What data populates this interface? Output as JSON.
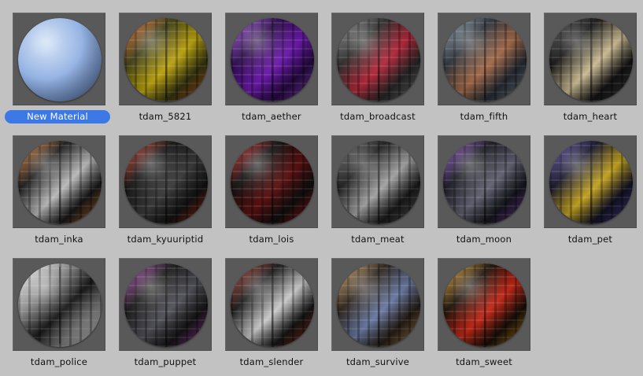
{
  "materials": [
    {
      "label": "New Material",
      "selected": true,
      "icon": "default-material-sphere-icon",
      "colors": [
        "#c9dbf3",
        "#95b3e3",
        "#5f7fb8"
      ]
    },
    {
      "label": "tdam_5821",
      "selected": false,
      "icon": "tdam-5821-material-sphere-icon",
      "colors": [
        "#e0601a",
        "#b8a010",
        "#3a3a12"
      ]
    },
    {
      "label": "tdam_aether",
      "selected": false,
      "icon": "tdam-aether-material-sphere-icon",
      "colors": [
        "#a04ee0",
        "#6a1aa8",
        "#2a0a48"
      ]
    },
    {
      "label": "tdam_broadcast",
      "selected": false,
      "icon": "tdam-broadcast-material-sphere-icon",
      "colors": [
        "#8a8a8a",
        "#b0283a",
        "#2a2a2a"
      ]
    },
    {
      "label": "tdam_fifth",
      "selected": false,
      "icon": "tdam-fifth-material-sphere-icon",
      "colors": [
        "#8a9aa8",
        "#a06848",
        "#2a3038"
      ]
    },
    {
      "label": "tdam_heart",
      "selected": false,
      "icon": "tdam-heart-material-sphere-icon",
      "colors": [
        "#4a4a4a",
        "#c8b890",
        "#151515"
      ]
    },
    {
      "label": "tdam_inka",
      "selected": false,
      "icon": "tdam-inka-material-sphere-icon",
      "colors": [
        "#e07a28",
        "#b8b8b8",
        "#1a1a1a"
      ]
    },
    {
      "label": "tdam_kyuuriptid",
      "selected": false,
      "icon": "tdam-kyuuriptid-material-sphere-icon",
      "colors": [
        "#c83018",
        "#3a3a3a",
        "#141414"
      ]
    },
    {
      "label": "tdam_lois",
      "selected": false,
      "icon": "tdam-lois-material-sphere-icon",
      "colors": [
        "#d01818",
        "#5a1010",
        "#101010"
      ]
    },
    {
      "label": "tdam_meat",
      "selected": false,
      "icon": "tdam-meat-material-sphere-icon",
      "colors": [
        "#6a6a6a",
        "#a0a0a0",
        "#1c1c1c"
      ]
    },
    {
      "label": "tdam_moon",
      "selected": false,
      "icon": "tdam-moon-material-sphere-icon",
      "colors": [
        "#8848c8",
        "#606070",
        "#181820"
      ]
    },
    {
      "label": "tdam_pet",
      "selected": false,
      "icon": "tdam-pet-material-sphere-icon",
      "colors": [
        "#5a48a8",
        "#c0a020",
        "#141428"
      ]
    },
    {
      "label": "tdam_police",
      "selected": false,
      "icon": "tdam-police-material-sphere-icon",
      "colors": [
        "#f0f0f0",
        "#1a1a1a",
        "#909090"
      ]
    },
    {
      "label": "tdam_puppet",
      "selected": false,
      "icon": "tdam-puppet-material-sphere-icon",
      "colors": [
        "#b040b8",
        "#505058",
        "#181818"
      ]
    },
    {
      "label": "tdam_slender",
      "selected": false,
      "icon": "tdam-slender-material-sphere-icon",
      "colors": [
        "#a83020",
        "#c8c8c8",
        "#181818"
      ]
    },
    {
      "label": "tdam_survive",
      "selected": false,
      "icon": "tdam-survive-material-sphere-icon",
      "colors": [
        "#d0a060",
        "#6878a0",
        "#2a2018"
      ]
    },
    {
      "label": "tdam_sweet",
      "selected": false,
      "icon": "tdam-sweet-material-sphere-icon",
      "colors": [
        "#e8a020",
        "#c02818",
        "#1a1008"
      ]
    }
  ]
}
